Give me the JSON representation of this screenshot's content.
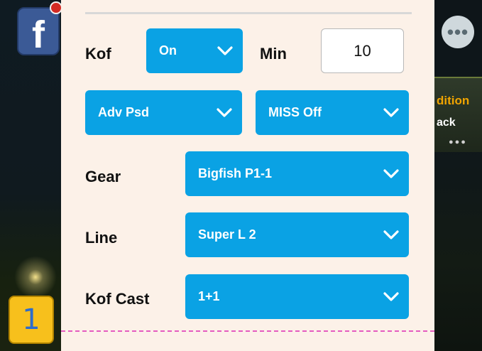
{
  "panel": {
    "kof_label": "Kof",
    "kof_dropdown": "On",
    "min_label": "Min",
    "min_value": "10",
    "adv_dropdown": "Adv Psd",
    "miss_dropdown": "MISS Off",
    "gear_label": "Gear",
    "gear_dropdown": "Bigfish P1-1",
    "line_label": "Line",
    "line_dropdown": "Super L 2",
    "kofcast_label": "Kof Cast",
    "kofcast_dropdown": "1+1"
  },
  "background": {
    "facebook_glyph": "f",
    "more_dots": "•••",
    "promo_title": "dition",
    "promo_sub": "ack",
    "promo_dots": "●●●"
  },
  "overlay": {
    "badge_number": "1"
  },
  "colors": {
    "dropdown_blue": "#0aa2e4",
    "panel_bg": "#fcf1e8",
    "badge_yellow": "#f7c01c",
    "dashed_line_pink": "#e55bc0"
  }
}
